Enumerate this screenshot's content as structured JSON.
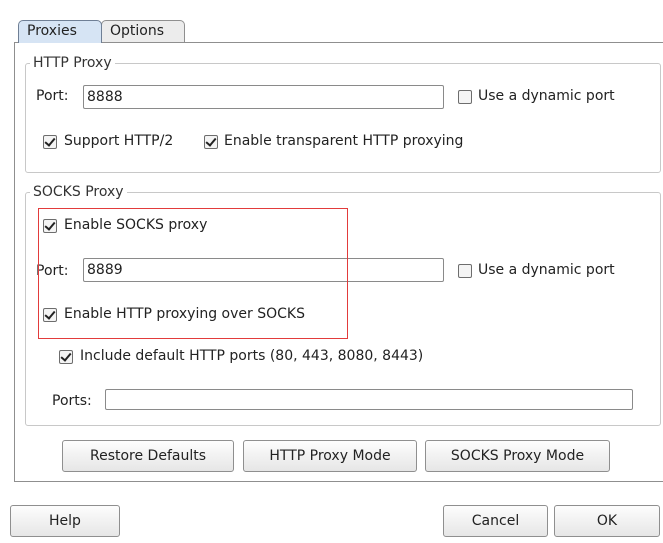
{
  "tabs": [
    {
      "label": "Proxies",
      "active": true
    },
    {
      "label": "Options",
      "active": false
    }
  ],
  "http_proxy": {
    "legend": "HTTP Proxy",
    "port_label": "Port:",
    "port_value": "8888",
    "dynamic_port_label": "Use a dynamic port",
    "dynamic_port_checked": false,
    "support_http2_label": "Support HTTP/2",
    "support_http2_checked": true,
    "transparent_label": "Enable transparent HTTP proxying",
    "transparent_checked": true
  },
  "socks_proxy": {
    "legend": "SOCKS Proxy",
    "enable_label": "Enable SOCKS proxy",
    "enable_checked": true,
    "port_label": "Port:",
    "port_value": "8889",
    "dynamic_port_label": "Use a dynamic port",
    "dynamic_port_checked": false,
    "http_over_socks_label": "Enable HTTP proxying over SOCKS",
    "http_over_socks_checked": true,
    "include_default_label": "Include default HTTP ports (80, 443, 8080, 8443)",
    "include_default_checked": true,
    "ports_label": "Ports:",
    "ports_value": ""
  },
  "mode_buttons": {
    "restore": "Restore Defaults",
    "http_mode": "HTTP Proxy Mode",
    "socks_mode": "SOCKS Proxy Mode"
  },
  "footer": {
    "help": "Help",
    "cancel": "Cancel",
    "ok": "OK"
  },
  "colors": {
    "highlight": "#e23b3b",
    "active_tab": "#d6e4f4"
  }
}
